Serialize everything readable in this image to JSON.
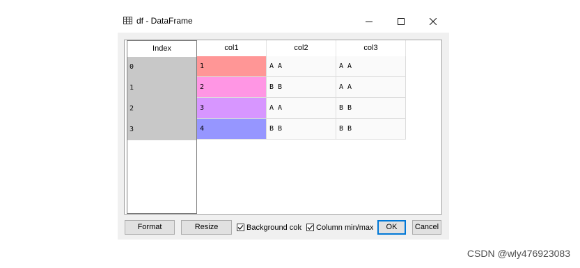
{
  "window": {
    "title": "df - DataFrame"
  },
  "table": {
    "index_header": "Index",
    "columns": [
      "col1",
      "col2",
      "col3"
    ],
    "index": [
      "0",
      "1",
      "2",
      "3"
    ],
    "rows": [
      [
        "1",
        "A  A",
        "A  A"
      ],
      [
        "2",
        "B  B",
        "A  A"
      ],
      [
        "3",
        "A  A",
        "B  B"
      ],
      [
        "4",
        "B  B",
        "B  B"
      ]
    ],
    "col1_colors": [
      "#ff9696",
      "#ff96e4",
      "#d796ff",
      "#9696ff"
    ],
    "index_color": "#c8c8c8"
  },
  "buttons": {
    "format": "Format",
    "resize": "Resize",
    "ok": "OK",
    "cancel": "Cancel"
  },
  "checkboxes": {
    "background_color": {
      "label": "Background color",
      "checked": true
    },
    "column_minmax": {
      "label": "Column min/max",
      "checked": true
    }
  },
  "icons": [
    "table-icon",
    "minimize-icon",
    "maximize-icon",
    "close-icon",
    "checkmark-icon"
  ],
  "watermark": "CSDN @wly476923083"
}
